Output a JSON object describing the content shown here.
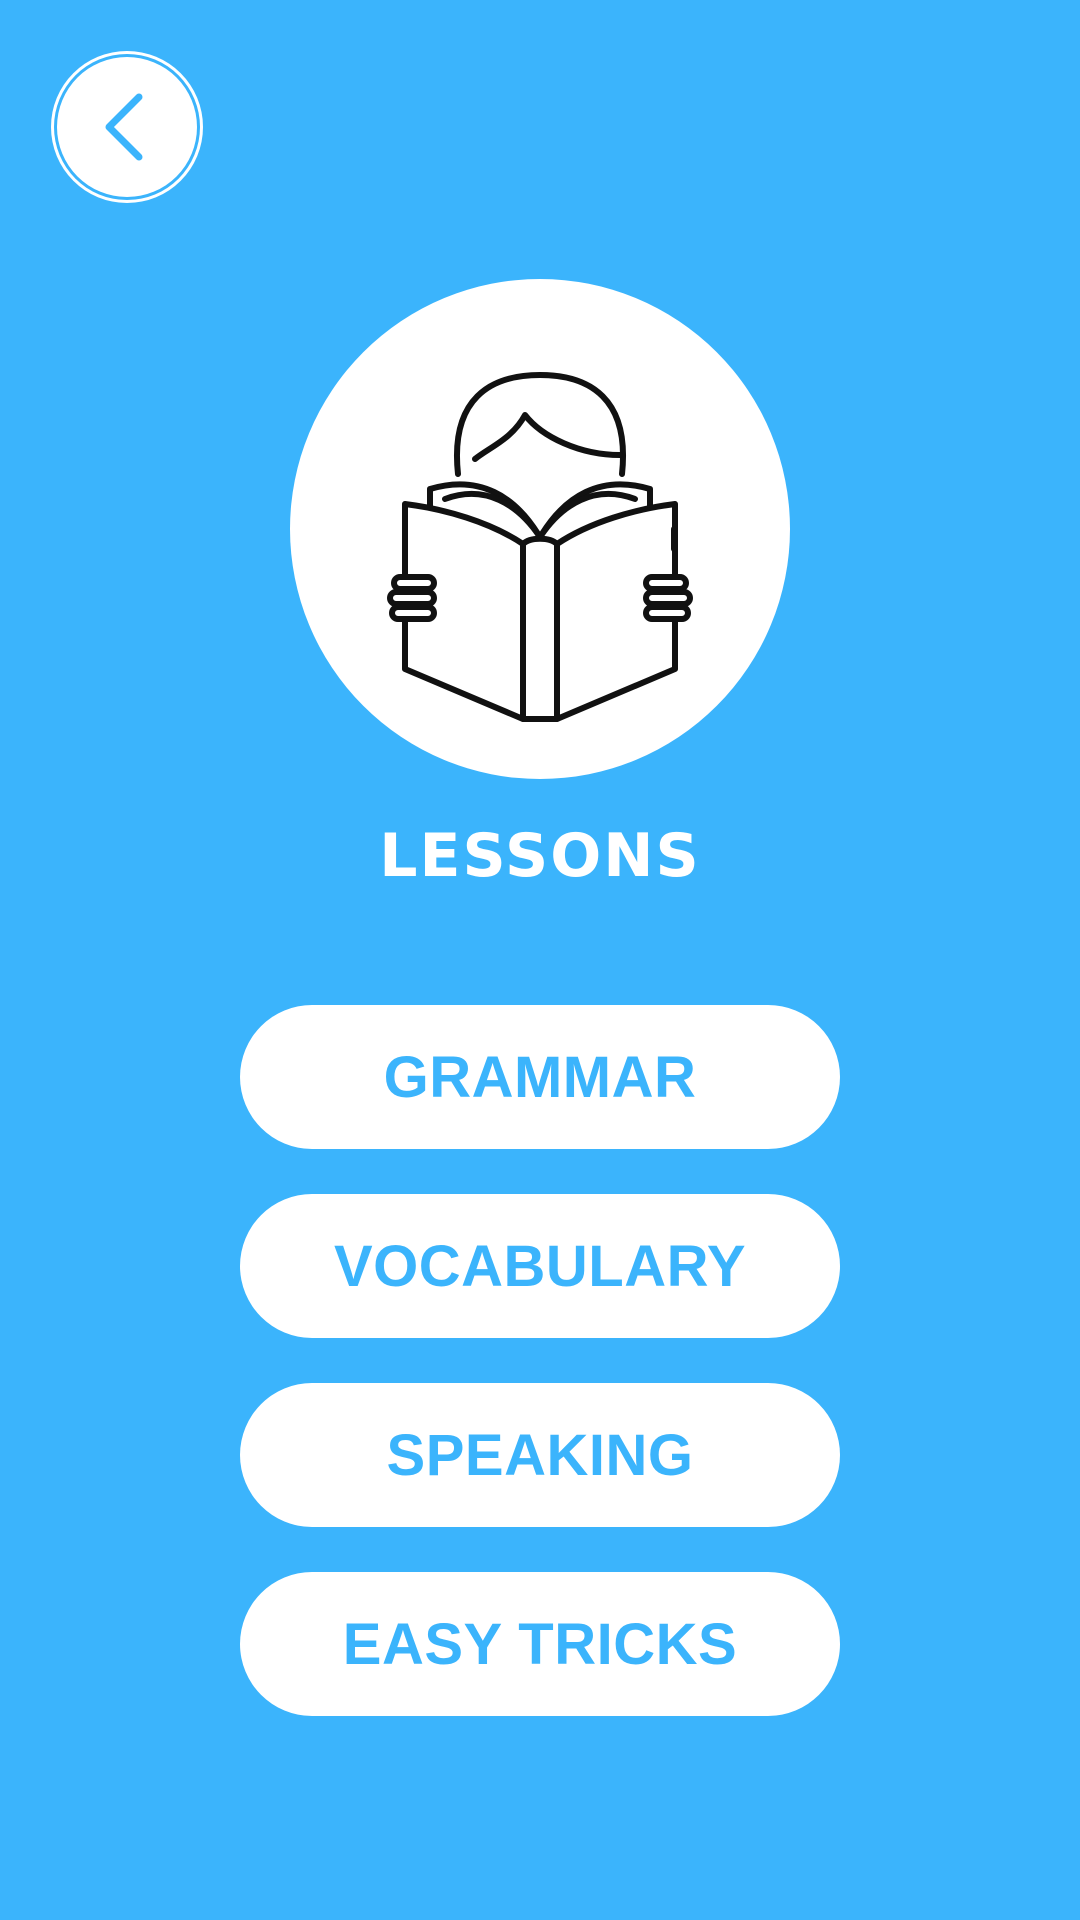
{
  "header": {
    "back_icon": "chevron-left-icon"
  },
  "hero": {
    "icon": "person-reading-book-icon",
    "title": "LESSONS"
  },
  "menu": {
    "items": [
      {
        "label": "GRAMMAR"
      },
      {
        "label": "VOCABULARY"
      },
      {
        "label": "SPEAKING"
      },
      {
        "label": "EASY TRICKS"
      }
    ]
  },
  "colors": {
    "background": "#3bb4fc",
    "button_background": "#ffffff",
    "button_text": "#3bb4fc",
    "title_text": "#ffffff"
  }
}
